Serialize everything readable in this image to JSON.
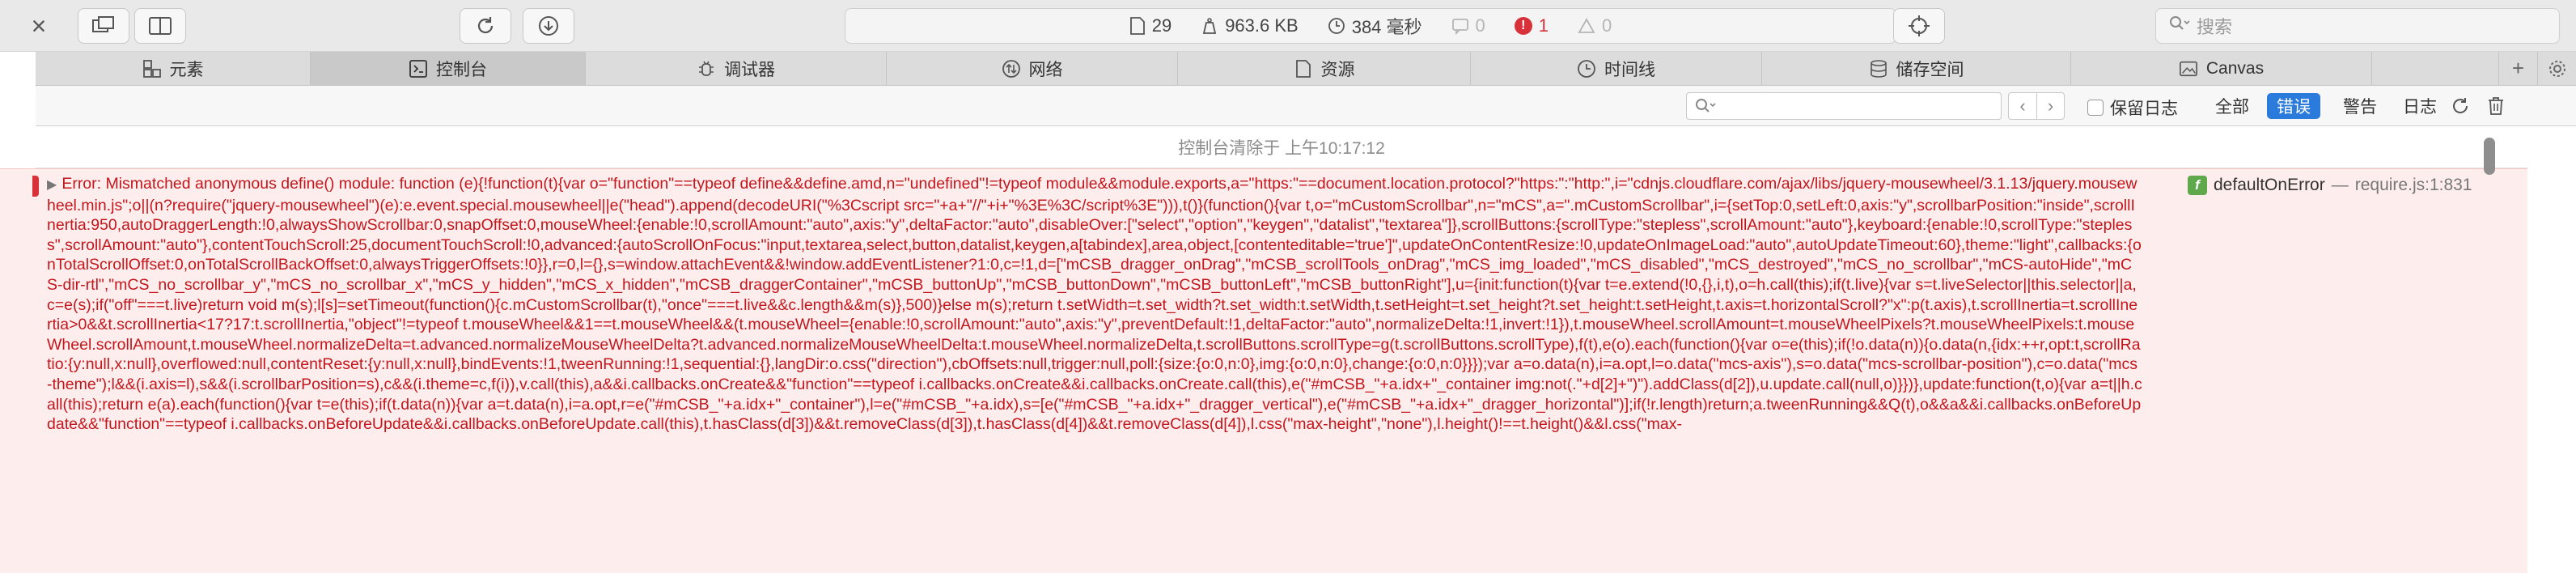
{
  "toolbar": {
    "requests": "29",
    "size": "963.6 KB",
    "time": "384 毫秒",
    "logs": "0",
    "errors": "1",
    "warnings": "0",
    "search_placeholder": "搜索"
  },
  "tabs": [
    {
      "label": "元素",
      "icon": "elements-icon"
    },
    {
      "label": "控制台",
      "icon": "console-icon"
    },
    {
      "label": "调试器",
      "icon": "debugger-icon"
    },
    {
      "label": "网络",
      "icon": "network-icon"
    },
    {
      "label": "资源",
      "icon": "resources-icon"
    },
    {
      "label": "时间线",
      "icon": "timeline-icon"
    },
    {
      "label": "储存空间",
      "icon": "storage-icon"
    },
    {
      "label": "Canvas",
      "icon": "canvas-icon"
    }
  ],
  "filter": {
    "placeholder": "",
    "preserve_log": "保留日志",
    "levels": [
      "全部",
      "错误",
      "警告",
      "日志"
    ],
    "active_level": "错误"
  },
  "console": {
    "cleared_message": "控制台清除于 上午10:17:12",
    "error": {
      "text": "Error: Mismatched anonymous define() module: function (e){!function(t){var o=\"function\"==typeof define&&define.amd,n=\"undefined\"!=typeof module&&module.exports,a=\"https:\"==document.location.protocol?\"https:\":\"http:\",i=\"cdnjs.cloudflare.com/ajax/libs/jquery-mousewheel/3.1.13/jquery.mousewheel.min.js\";o||(n?require(\"jquery-mousewheel\")(e):e.event.special.mousewheel||e(\"head\").append(decodeURI(\"%3Cscript src=\"+a+\"//\"+i+\"%3E%3C/script%3E\"))),t()}(function(){var t,o=\"mCustomScrollbar\",n=\"mCS\",a=\".mCustomScrollbar\",i={setTop:0,setLeft:0,axis:\"y\",scrollbarPosition:\"inside\",scrollInertia:950,autoDraggerLength:!0,alwaysShowScrollbar:0,snapOffset:0,mouseWheel:{enable:!0,scrollAmount:\"auto\",axis:\"y\",deltaFactor:\"auto\",disableOver:[\"select\",\"option\",\"keygen\",\"datalist\",\"textarea\"]},scrollButtons:{scrollType:\"stepless\",scrollAmount:\"auto\"},keyboard:{enable:!0,scrollType:\"stepless\",scrollAmount:\"auto\"},contentTouchScroll:25,documentTouchScroll:!0,advanced:{autoScrollOnFocus:\"input,textarea,select,button,datalist,keygen,a[tabindex],area,object,[contenteditable='true']\",updateOnContentResize:!0,updateOnImageLoad:\"auto\",autoUpdateTimeout:60},theme:\"light\",callbacks:{onTotalScrollOffset:0,onTotalScrollBackOffset:0,alwaysTriggerOffsets:!0}},r=0,l={},s=window.attachEvent&&!window.addEventListener?1:0,c=!1,d=[\"mCSB_dragger_onDrag\",\"mCSB_scrollTools_onDrag\",\"mCS_img_loaded\",\"mCS_disabled\",\"mCS_destroyed\",\"mCS_no_scrollbar\",\"mCS-autoHide\",\"mCS-dir-rtl\",\"mCS_no_scrollbar_y\",\"mCS_no_scrollbar_x\",\"mCS_y_hidden\",\"mCS_x_hidden\",\"mCSB_draggerContainer\",\"mCSB_buttonUp\",\"mCSB_buttonDown\",\"mCSB_buttonLeft\",\"mCSB_buttonRight\"],u={init:function(t){var t=e.extend(!0,{},i,t),o=h.call(this);if(t.live){var s=t.liveSelector||this.selector||a,c=e(s);if(\"off\"===t.live)return void m(s);l[s]=setTimeout(function(){c.mCustomScrollbar(t),\"once\"===t.live&&c.length&&m(s)},500)}else m(s);return t.setWidth=t.set_width?t.set_width:t.setWidth,t.setHeight=t.set_height?t.set_height:t.setHeight,t.axis=t.horizontalScroll?\"x\":p(t.axis),t.scrollInertia=t.scrollInertia>0&&t.scrollInertia<17?17:t.scrollInertia,\"object\"!=typeof t.mouseWheel&&1==t.mouseWheel&&(t.mouseWheel={enable:!0,scrollAmount:\"auto\",axis:\"y\",preventDefault:!1,deltaFactor:\"auto\",normalizeDelta:!1,invert:!1}),t.mouseWheel.scrollAmount=t.mouseWheelPixels?t.mouseWheelPixels:t.mouseWheel.scrollAmount,t.mouseWheel.normalizeDelta=t.advanced.normalizeMouseWheelDelta?t.advanced.normalizeMouseWheelDelta:t.mouseWheel.normalizeDelta,t.scrollButtons.scrollType=g(t.scrollButtons.scrollType),f(t),e(o).each(function(){var o=e(this);if(!o.data(n)){o.data(n,{idx:++r,opt:t,scrollRatio:{y:null,x:null},overflowed:null,contentReset:{y:null,x:null},bindEvents:!1,tweenRunning:!1,sequential:{},langDir:o.css(\"direction\"),cbOffsets:null,trigger:null,poll:{size:{o:0,n:0},img:{o:0,n:0},change:{o:0,n:0}}});var a=o.data(n),i=a.opt,l=o.data(\"mcs-axis\"),s=o.data(\"mcs-scrollbar-position\"),c=o.data(\"mcs-theme\");l&&(i.axis=l),s&&(i.scrollbarPosition=s),c&&(i.theme=c,f(i)),v.call(this),a&&i.callbacks.onCreate&&\"function\"==typeof i.callbacks.onCreate&&i.callbacks.onCreate.call(this),e(\"#mCSB_\"+a.idx+\"_container img:not(.\"+d[2]+\")\").addClass(d[2]),u.update.call(null,o)}})},update:function(t,o){var a=t||h.call(this);return e(a).each(function(){var t=e(this);if(t.data(n)){var a=t.data(n),i=a.opt,r=e(\"#mCSB_\"+a.idx+\"_container\"),l=e(\"#mCSB_\"+a.idx),s=[e(\"#mCSB_\"+a.idx+\"_dragger_vertical\"),e(\"#mCSB_\"+a.idx+\"_dragger_horizontal\")];if(!r.length)return;a.tweenRunning&&Q(t),o&&a&&i.callbacks.onBeforeUpdate&&\"function\"==typeof i.callbacks.onBeforeUpdate&&i.callbacks.onBeforeUpdate.call(this),t.hasClass(d[3])&&t.removeClass(d[3]),t.hasClass(d[4])&&t.removeClass(d[4]),l.css(\"max-height\",\"none\"),l.height()!==t.height()&&l.css(\"max-",
      "function_name": "defaultOnError",
      "separator": "—",
      "location": "require.js:1:831"
    }
  }
}
